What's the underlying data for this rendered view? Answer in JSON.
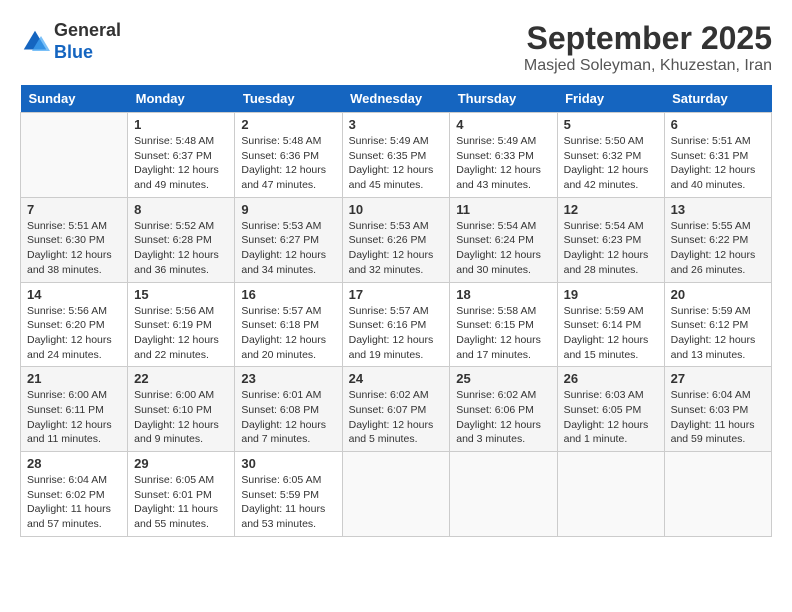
{
  "logo": {
    "line1": "General",
    "line2": "Blue"
  },
  "header": {
    "month": "September 2025",
    "location": "Masjed Soleyman, Khuzestan, Iran"
  },
  "days": [
    "Sunday",
    "Monday",
    "Tuesday",
    "Wednesday",
    "Thursday",
    "Friday",
    "Saturday"
  ],
  "weeks": [
    [
      {
        "num": "",
        "info": ""
      },
      {
        "num": "1",
        "info": "Sunrise: 5:48 AM\nSunset: 6:37 PM\nDaylight: 12 hours\nand 49 minutes."
      },
      {
        "num": "2",
        "info": "Sunrise: 5:48 AM\nSunset: 6:36 PM\nDaylight: 12 hours\nand 47 minutes."
      },
      {
        "num": "3",
        "info": "Sunrise: 5:49 AM\nSunset: 6:35 PM\nDaylight: 12 hours\nand 45 minutes."
      },
      {
        "num": "4",
        "info": "Sunrise: 5:49 AM\nSunset: 6:33 PM\nDaylight: 12 hours\nand 43 minutes."
      },
      {
        "num": "5",
        "info": "Sunrise: 5:50 AM\nSunset: 6:32 PM\nDaylight: 12 hours\nand 42 minutes."
      },
      {
        "num": "6",
        "info": "Sunrise: 5:51 AM\nSunset: 6:31 PM\nDaylight: 12 hours\nand 40 minutes."
      }
    ],
    [
      {
        "num": "7",
        "info": "Sunrise: 5:51 AM\nSunset: 6:30 PM\nDaylight: 12 hours\nand 38 minutes."
      },
      {
        "num": "8",
        "info": "Sunrise: 5:52 AM\nSunset: 6:28 PM\nDaylight: 12 hours\nand 36 minutes."
      },
      {
        "num": "9",
        "info": "Sunrise: 5:53 AM\nSunset: 6:27 PM\nDaylight: 12 hours\nand 34 minutes."
      },
      {
        "num": "10",
        "info": "Sunrise: 5:53 AM\nSunset: 6:26 PM\nDaylight: 12 hours\nand 32 minutes."
      },
      {
        "num": "11",
        "info": "Sunrise: 5:54 AM\nSunset: 6:24 PM\nDaylight: 12 hours\nand 30 minutes."
      },
      {
        "num": "12",
        "info": "Sunrise: 5:54 AM\nSunset: 6:23 PM\nDaylight: 12 hours\nand 28 minutes."
      },
      {
        "num": "13",
        "info": "Sunrise: 5:55 AM\nSunset: 6:22 PM\nDaylight: 12 hours\nand 26 minutes."
      }
    ],
    [
      {
        "num": "14",
        "info": "Sunrise: 5:56 AM\nSunset: 6:20 PM\nDaylight: 12 hours\nand 24 minutes."
      },
      {
        "num": "15",
        "info": "Sunrise: 5:56 AM\nSunset: 6:19 PM\nDaylight: 12 hours\nand 22 minutes."
      },
      {
        "num": "16",
        "info": "Sunrise: 5:57 AM\nSunset: 6:18 PM\nDaylight: 12 hours\nand 20 minutes."
      },
      {
        "num": "17",
        "info": "Sunrise: 5:57 AM\nSunset: 6:16 PM\nDaylight: 12 hours\nand 19 minutes."
      },
      {
        "num": "18",
        "info": "Sunrise: 5:58 AM\nSunset: 6:15 PM\nDaylight: 12 hours\nand 17 minutes."
      },
      {
        "num": "19",
        "info": "Sunrise: 5:59 AM\nSunset: 6:14 PM\nDaylight: 12 hours\nand 15 minutes."
      },
      {
        "num": "20",
        "info": "Sunrise: 5:59 AM\nSunset: 6:12 PM\nDaylight: 12 hours\nand 13 minutes."
      }
    ],
    [
      {
        "num": "21",
        "info": "Sunrise: 6:00 AM\nSunset: 6:11 PM\nDaylight: 12 hours\nand 11 minutes."
      },
      {
        "num": "22",
        "info": "Sunrise: 6:00 AM\nSunset: 6:10 PM\nDaylight: 12 hours\nand 9 minutes."
      },
      {
        "num": "23",
        "info": "Sunrise: 6:01 AM\nSunset: 6:08 PM\nDaylight: 12 hours\nand 7 minutes."
      },
      {
        "num": "24",
        "info": "Sunrise: 6:02 AM\nSunset: 6:07 PM\nDaylight: 12 hours\nand 5 minutes."
      },
      {
        "num": "25",
        "info": "Sunrise: 6:02 AM\nSunset: 6:06 PM\nDaylight: 12 hours\nand 3 minutes."
      },
      {
        "num": "26",
        "info": "Sunrise: 6:03 AM\nSunset: 6:05 PM\nDaylight: 12 hours\nand 1 minute."
      },
      {
        "num": "27",
        "info": "Sunrise: 6:04 AM\nSunset: 6:03 PM\nDaylight: 11 hours\nand 59 minutes."
      }
    ],
    [
      {
        "num": "28",
        "info": "Sunrise: 6:04 AM\nSunset: 6:02 PM\nDaylight: 11 hours\nand 57 minutes."
      },
      {
        "num": "29",
        "info": "Sunrise: 6:05 AM\nSunset: 6:01 PM\nDaylight: 11 hours\nand 55 minutes."
      },
      {
        "num": "30",
        "info": "Sunrise: 6:05 AM\nSunset: 5:59 PM\nDaylight: 11 hours\nand 53 minutes."
      },
      {
        "num": "",
        "info": ""
      },
      {
        "num": "",
        "info": ""
      },
      {
        "num": "",
        "info": ""
      },
      {
        "num": "",
        "info": ""
      }
    ]
  ]
}
